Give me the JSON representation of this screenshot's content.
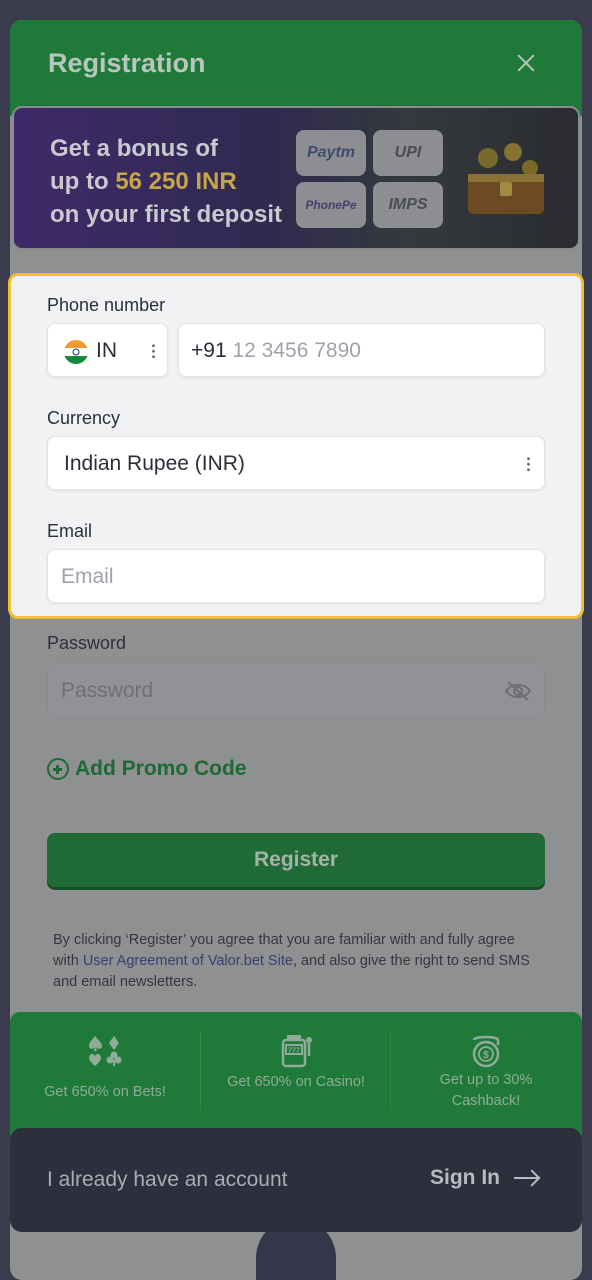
{
  "header": {
    "title": "Registration"
  },
  "banner": {
    "line1": "Get a bonus of",
    "line2_prefix": "up to ",
    "line2_amount": "56 250 INR",
    "line3": "on your first deposit",
    "payments": [
      "Paytm",
      "UPI",
      "PhonePe",
      "IMPS"
    ]
  },
  "form": {
    "phone_label": "Phone number",
    "country_code": "IN",
    "phone_prefix": "+91",
    "phone_placeholder": "12 3456 7890",
    "currency_label": "Currency",
    "currency_value": "Indian Rupee (INR)",
    "email_label": "Email",
    "email_placeholder": "Email",
    "password_label": "Password",
    "password_placeholder": "Password",
    "promo_label": "Add Promo Code",
    "register_label": "Register",
    "terms_prefix": "By clicking ‘Register’ you agree that you are familiar with and fully agree with ",
    "terms_link": "User Agreement of Valor.bet Site",
    "terms_suffix": ", and also give the right to send SMS and email newsletters."
  },
  "features": [
    {
      "icon": "cards-suits-icon",
      "text": "Get 650% on Bets!"
    },
    {
      "icon": "slot-machine-icon",
      "text": "Get 650% on Casino!"
    },
    {
      "icon": "cashback-coin-icon",
      "text": "Get up to 30% Cashback!"
    }
  ],
  "footer": {
    "have_account": "I already have an account",
    "sign_in": "Sign In"
  },
  "colors": {
    "brand_green": "#1f7a3a",
    "highlight_border": "#f0c230",
    "bonus_amount": "#c4a548"
  }
}
